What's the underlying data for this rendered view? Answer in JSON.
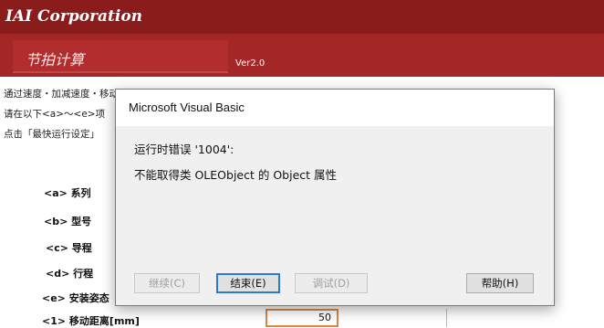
{
  "header": {
    "brand": "IAI Corporation",
    "calc_title": "节拍计算",
    "version": "Ver2.0"
  },
  "description": {
    "line1": "通过速度・加减速度・移动距离自动计算单轴机械手的定位时间（Cycle Time）",
    "line2": "请在以下<a>～<e>项",
    "line3": "点击「最快运行设定」"
  },
  "fields": [
    {
      "label": "<a> 系列"
    },
    {
      "label": "<b> 型号"
    },
    {
      "label": "<c> 导程"
    },
    {
      "label": "<d> 行程"
    },
    {
      "label": "<e> 安装姿态"
    },
    {
      "label": "<1> 移动距离[mm]"
    }
  ],
  "distance_value": "50",
  "dialog": {
    "title": "Microsoft Visual Basic",
    "error_line1": "运行时错误 '1004':",
    "error_line2": "不能取得类 OLEObject 的 Object 属性",
    "buttons": {
      "continue": "继续(C)",
      "end": "结束(E)",
      "debug": "调试(D)",
      "help": "帮助(H)"
    }
  }
}
